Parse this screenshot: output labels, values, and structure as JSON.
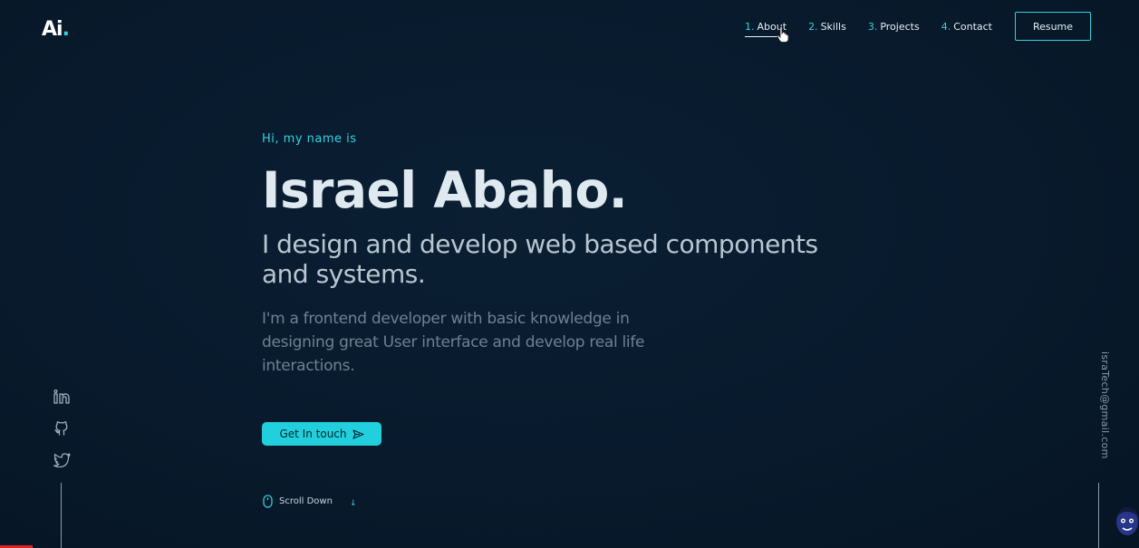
{
  "header": {
    "logo_text": "Ai",
    "logo_dot": ".",
    "nav": [
      {
        "num": "1.",
        "label": "About"
      },
      {
        "num": "2.",
        "label": "Skills"
      },
      {
        "num": "3.",
        "label": "Projects"
      },
      {
        "num": "4.",
        "label": "Contact"
      }
    ],
    "resume_label": "Resume"
  },
  "hero": {
    "greeting": "Hi, my name is",
    "name": "Israel Abaho.",
    "tagline": "I design and develop web based components and systems.",
    "description": "I'm a frontend developer with basic knowledge in designing great User interface and develop real life interactions.",
    "cta_label": "Get In touch",
    "scroll_label": "Scroll Down"
  },
  "social": [
    "linkedin-icon",
    "github-icon",
    "twitter-icon"
  ],
  "email": "israTech@gmail.com",
  "colors": {
    "accent": "#2fd3de",
    "background": "#081a2c",
    "heading": "#dfe9f0",
    "muted": "#6f8190"
  }
}
